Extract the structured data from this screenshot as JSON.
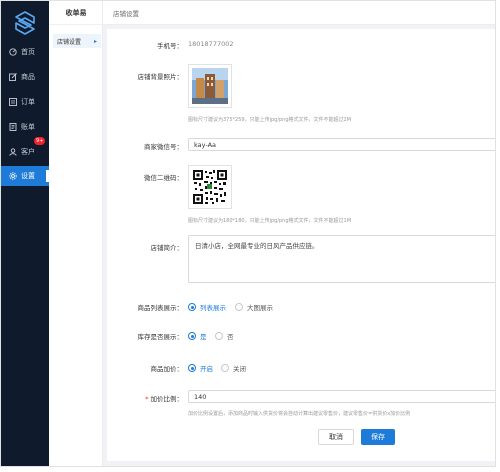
{
  "nav": {
    "items": [
      {
        "label": "首页",
        "icon": "home-icon"
      },
      {
        "label": "商品",
        "icon": "edit-icon"
      },
      {
        "label": "订单",
        "icon": "order-icon"
      },
      {
        "label": "账单",
        "icon": "bill-icon"
      },
      {
        "label": "客户",
        "icon": "user-icon",
        "badge": "9+"
      },
      {
        "label": "设置",
        "icon": "settings-icon"
      }
    ],
    "active_index": 5,
    "colors": {
      "bg": "#0f1a2c",
      "active": "#1e7bd8"
    }
  },
  "subnav": {
    "title": "收单易",
    "item": "店铺设置"
  },
  "header": {
    "breadcrumb": "店铺设置"
  },
  "form": {
    "phone": {
      "label": "手机号：",
      "value": "18018777002"
    },
    "background": {
      "label": "店铺背景照片：",
      "hint": "图标尺寸建议为375*259，只能上传jpg/png格式文件，文件不能超过2M"
    },
    "wechat": {
      "label": "商家微信号：",
      "value": "kay-Aa"
    },
    "qrcode": {
      "label": "微信二维码：",
      "hint": "图标尺寸建议为180*180，只能上传jpg/png格式文件，文件不能超过1M"
    },
    "intro": {
      "label": "店铺简介：",
      "value": "日清小店，全网最专业的日风产品供应链。"
    },
    "list_display": {
      "label": "商品列表展示：",
      "options": [
        "列表展示",
        "大图展示"
      ],
      "selected": 0
    },
    "stock_display": {
      "label": "库存是否展示：",
      "options": [
        "是",
        "否"
      ],
      "selected": 0
    },
    "markup": {
      "label": "商品加价：",
      "options": [
        "开启",
        "关闭"
      ],
      "selected": 0
    },
    "ratio": {
      "required_mark": "*",
      "label": "加价比例：",
      "value": "140",
      "hint": "加价比例设置后，添加商品时输入供货价将会自动计算出建议零售价，建议零售价=供货价x加价比例"
    },
    "buttons": {
      "cancel": "取消",
      "save": "保存"
    }
  },
  "accent": "#1e7bd8"
}
